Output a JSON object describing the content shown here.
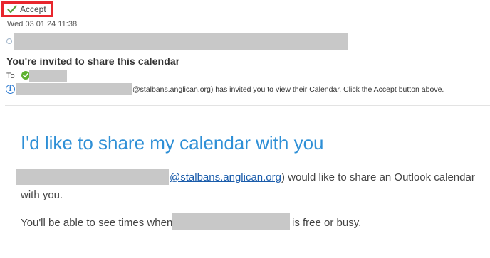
{
  "toolbar": {
    "accept_label": "Accept"
  },
  "message": {
    "timestamp": "Wed 03 01 24 11:38",
    "title": "You're invited to share this calendar",
    "to_label": "To",
    "info_text": "@stalbans.anglican.org) has invited you to view their Calendar.  Click the Accept button above."
  },
  "body": {
    "headline": "I'd like to share my calendar with you",
    "email_link": "@stalbans.anglican.org",
    "line1_suffix": ") would like to share an Outlook calendar",
    "line2": "with you.",
    "line3_prefix": "You'll be able to see times when",
    "line3_suffix": "is free or busy."
  },
  "colors": {
    "accent": "#2e8fd6",
    "highlight_border": "#e8262d",
    "ok_green": "#5db12f",
    "info_blue": "#2b79d0"
  },
  "icons": [
    "checkmark-icon",
    "radio-icon",
    "status-ok-icon",
    "info-icon"
  ]
}
